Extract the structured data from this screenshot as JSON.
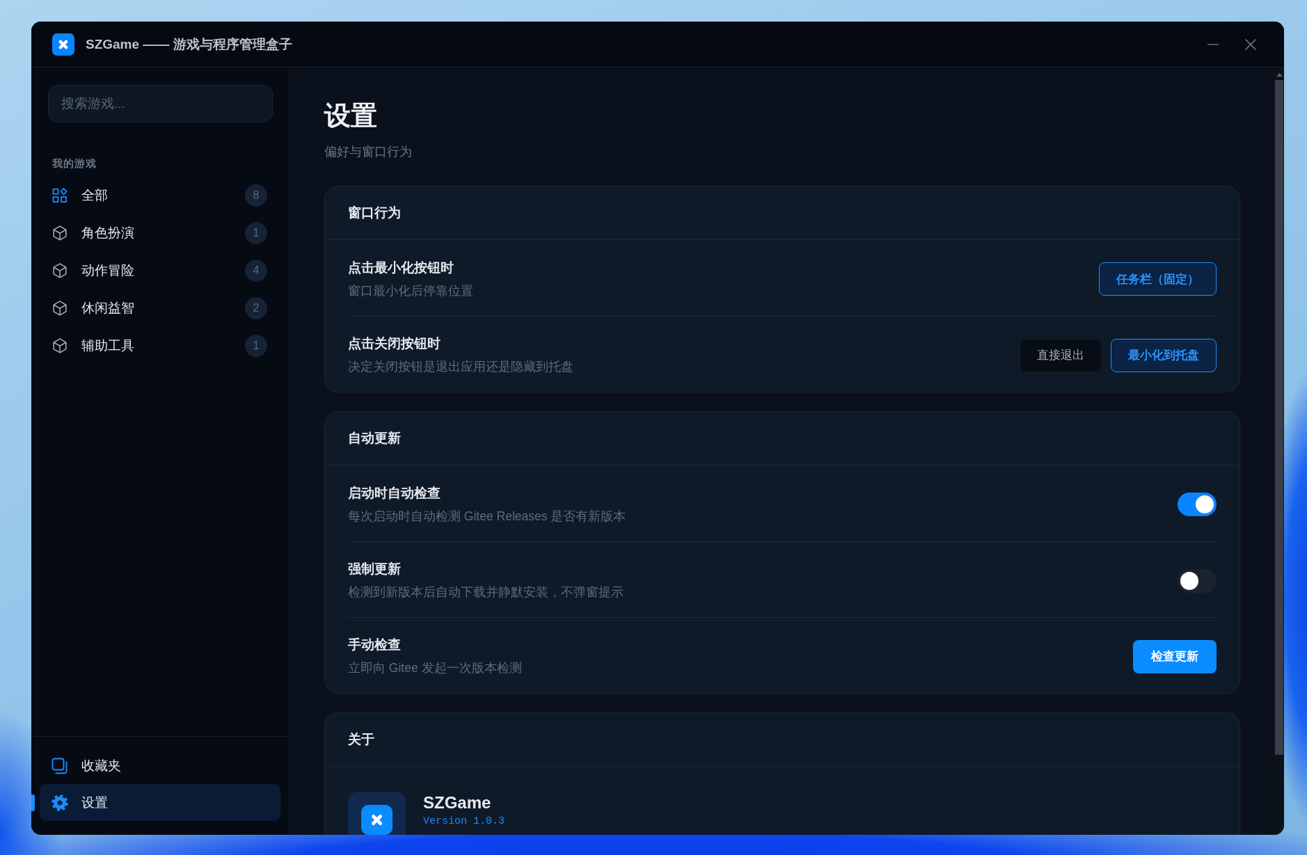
{
  "window": {
    "title": "SZGame —— 游戏与程序管理盒子"
  },
  "sidebar": {
    "search": {
      "placeholder": "搜索游戏..."
    },
    "section_label": "我的游戏",
    "categories": [
      {
        "kind": "all",
        "label": "全部",
        "count": "8",
        "selected": false
      },
      {
        "kind": "category",
        "label": "角色扮演",
        "count": "1",
        "selected": false
      },
      {
        "kind": "category",
        "label": "动作冒险",
        "count": "4",
        "selected": false
      },
      {
        "kind": "category",
        "label": "休闲益智",
        "count": "2",
        "selected": false
      },
      {
        "kind": "category",
        "label": "辅助工具",
        "count": "1",
        "selected": false
      }
    ],
    "bottom_items": [
      {
        "kind": "favorites",
        "label": "收藏夹",
        "selected": false
      },
      {
        "kind": "settings",
        "label": "设置",
        "selected": true
      }
    ]
  },
  "page": {
    "title": "设置",
    "subtitle": "偏好与窗口行为"
  },
  "sections": [
    {
      "kind": "settings",
      "title": "窗口行为",
      "rows": [
        {
          "kind": "choice",
          "title": "点击最小化按钮时",
          "description": "窗口最小化后停靠位置",
          "options": [
            {
              "label": "任务栏（固定）",
              "selected": true
            }
          ]
        },
        {
          "kind": "choice",
          "title": "点击关闭按钮时",
          "description": "决定关闭按钮是退出应用还是隐藏到托盘",
          "options": [
            {
              "label": "直接退出",
              "selected": false
            },
            {
              "label": "最小化到托盘",
              "selected": true
            }
          ]
        }
      ]
    },
    {
      "kind": "settings",
      "title": "自动更新",
      "rows": [
        {
          "kind": "toggle",
          "title": "启动时自动检查",
          "description": "每次启动时自动检测 Gitee Releases 是否有新版本",
          "on": true
        },
        {
          "kind": "toggle",
          "title": "强制更新",
          "description": "检测到新版本后自动下载并静默安装，不弹窗提示",
          "on": false
        },
        {
          "kind": "action",
          "title": "手动检查",
          "description": "立即向 Gitee 发起一次版本检测",
          "button": "检查更新"
        }
      ]
    },
    {
      "kind": "about",
      "title": "关于",
      "app": {
        "name": "SZGame",
        "version": "Version 1.0.3"
      }
    }
  ]
}
